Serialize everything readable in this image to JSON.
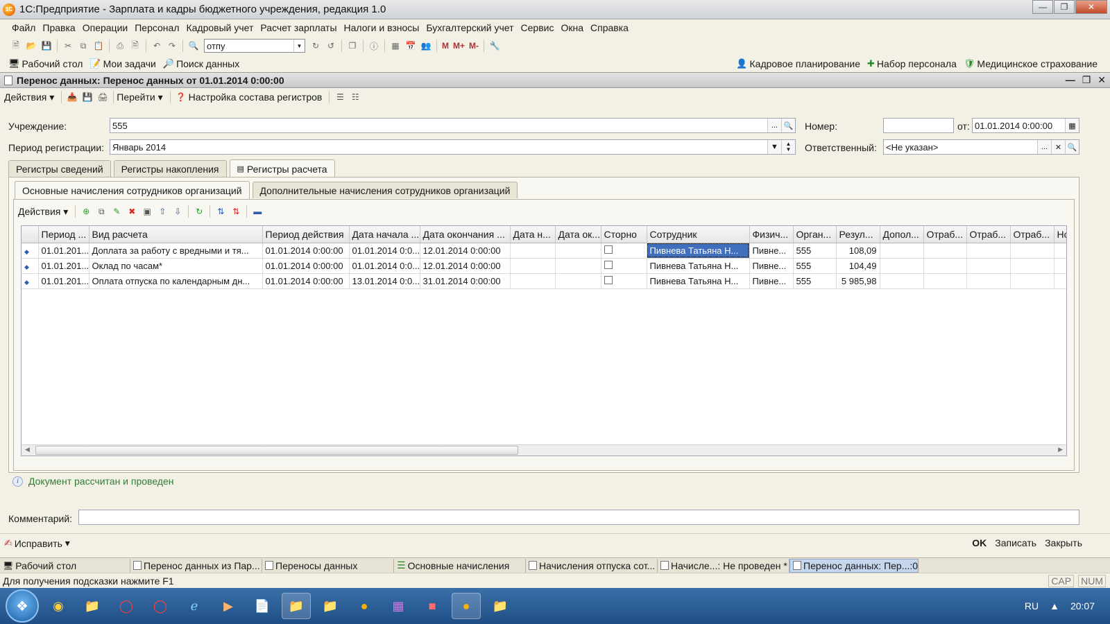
{
  "window": {
    "title": "1С:Предприятие - Зарплата и кадры бюджетного учреждения, редакция 1.0",
    "app_icon_text": "1С"
  },
  "menu": [
    "Файл",
    "Правка",
    "Операции",
    "Персонал",
    "Кадровый учет",
    "Расчет зарплаты",
    "Налоги и взносы",
    "Бухгалтерский учет",
    "Сервис",
    "Окна",
    "Справка"
  ],
  "toolbar": {
    "search_value": "отпу",
    "mem_labels": [
      "M",
      "M+",
      "M-"
    ]
  },
  "panel": {
    "left": [
      {
        "label": "Рабочий стол",
        "icon": "desktop-icon"
      },
      {
        "label": "Мои задачи",
        "icon": "tasks-icon"
      },
      {
        "label": "Поиск данных",
        "icon": "search-data-icon"
      }
    ],
    "right": [
      {
        "label": "Кадровое планирование",
        "icon": "planning-icon"
      },
      {
        "label": "Набор персонала",
        "icon": "recruit-icon"
      },
      {
        "label": "Медицинское страхование",
        "icon": "medical-icon"
      }
    ]
  },
  "document": {
    "title": "Перенос данных: Перенос данных  от 01.01.2014 0:00:00",
    "toolbar": {
      "actions": "Действия",
      "goto": "Перейти",
      "settings": "Настройка состава регистров"
    },
    "fields": {
      "org_label": "Учреждение:",
      "org_value": "555",
      "period_label": "Период регистрации:",
      "period_value": "Январь 2014",
      "number_label": "Номер:",
      "number_value": "",
      "date_label": "от:",
      "date_value": "01.01.2014  0:00:00",
      "responsible_label": "Ответственный:",
      "responsible_value": "<Не указан>"
    },
    "tabs": [
      "Регистры сведений",
      "Регистры накопления",
      "Регистры расчета"
    ],
    "subtabs": [
      "Основные начисления сотрудников организаций",
      "Дополнительные начисления сотрудников организаций"
    ],
    "grid_actions": "Действия",
    "columns": [
      "",
      "Период ...",
      "Вид расчета",
      "Период действия",
      "Дата начала ...",
      "Дата окончания ...",
      "Дата н...",
      "Дата ок...",
      "Сторно",
      "Сотрудник",
      "Физич...",
      "Орган...",
      "Резул...",
      "Допол...",
      "Отраб...",
      "Отраб...",
      "Отраб...",
      "Но"
    ],
    "rows": [
      {
        "period": "01.01.201...",
        "kind": "Доплата за работу с вредными и тя...",
        "action_period": "01.01.2014 0:00:00",
        "start": "01.01.2014 0:0...",
        "end": "12.01.2014 0:00:00",
        "dn": "",
        "dok": "",
        "storno": false,
        "employee": "Пивнева Татьяна Н...",
        "phys": "Пивне...",
        "org": "555",
        "result": "108,09"
      },
      {
        "period": "01.01.201...",
        "kind": "Оклад по часам*",
        "action_period": "01.01.2014 0:00:00",
        "start": "01.01.2014 0:0...",
        "end": "12.01.2014 0:00:00",
        "dn": "",
        "dok": "",
        "storno": false,
        "employee": "Пивнева Татьяна Н...",
        "phys": "Пивне...",
        "org": "555",
        "result": "104,49"
      },
      {
        "period": "01.01.201...",
        "kind": "Оплата отпуска по календарным дн...",
        "action_period": "01.01.2014 0:00:00",
        "start": "13.01.2014 0:0...",
        "end": "31.01.2014 0:00:00",
        "dn": "",
        "dok": "",
        "storno": false,
        "employee": "Пивнева Татьяна Н...",
        "phys": "Пивне...",
        "org": "555",
        "result": "5 985,98"
      }
    ],
    "info": "Документ рассчитан и проведен",
    "comment_label": "Комментарий:",
    "comment_value": "",
    "fix_button": "Исправить",
    "ok": "OK",
    "save": "Записать",
    "close": "Закрыть"
  },
  "window_tabs": [
    {
      "label": "Рабочий стол",
      "active": false
    },
    {
      "label": "Перенос данных из Пар...",
      "active": false
    },
    {
      "label": "Переносы данных",
      "active": false
    },
    {
      "label": "Основные начисления",
      "active": false
    },
    {
      "label": "Начисления отпуска сот...",
      "active": false
    },
    {
      "label": "Начисле...: Не проведен *",
      "active": false
    },
    {
      "label": "Перенос данных: Пер...:00",
      "active": true
    }
  ],
  "status": {
    "hint": "Для получения подсказки нажмите F1",
    "cap": "CAP",
    "num": "NUM"
  },
  "taskbar": {
    "lang": "RU",
    "time": "20:07"
  },
  "colors": {
    "selection": "#3f6fbd",
    "info_green": "#2e7d32",
    "panel_bg": "#f3f1e6"
  }
}
